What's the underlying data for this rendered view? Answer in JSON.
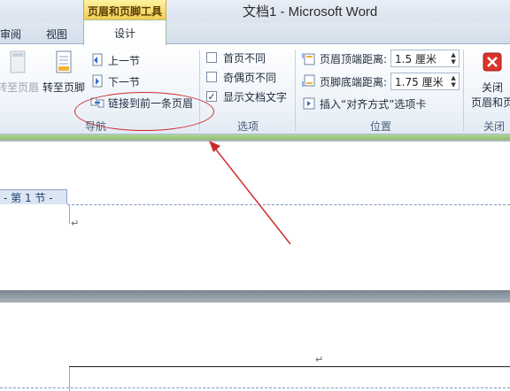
{
  "window": {
    "contextual_tab": "页眉和页脚工具",
    "title": "文档1 - Microsoft Word"
  },
  "tabs": {
    "review": "审阅",
    "view": "视图",
    "design": "设计"
  },
  "nav_group": {
    "goto_header": "转至页眉",
    "goto_footer": "转至页脚",
    "prev_section": "上一节",
    "next_section": "下一节",
    "link_previous": "链接到前一条页眉",
    "label": "导航"
  },
  "options_group": {
    "different_first": "首页不同",
    "different_odd_even": "奇偶页不同",
    "show_doc_text": "显示文档文字",
    "show_doc_text_checked": true,
    "label": "选项"
  },
  "position_group": {
    "header_top_label": "页眉顶端距离:",
    "header_top_value": "1.5 厘米",
    "footer_bottom_label": "页脚底端距离:",
    "footer_bottom_value": "1.75 厘米",
    "insert_align_tab": "插入“对齐方式”选项卡",
    "label": "位置"
  },
  "close_group": {
    "close_line1": "关闭",
    "close_line2": "页眉和页",
    "label": "关闭"
  },
  "document": {
    "section_tag": "- 第 1 节 -",
    "para_mark": "↵"
  },
  "colors": {
    "annotation": "#cc2b2b",
    "contextual": "#f2c84b",
    "accent_green": "#8fbf6c"
  }
}
